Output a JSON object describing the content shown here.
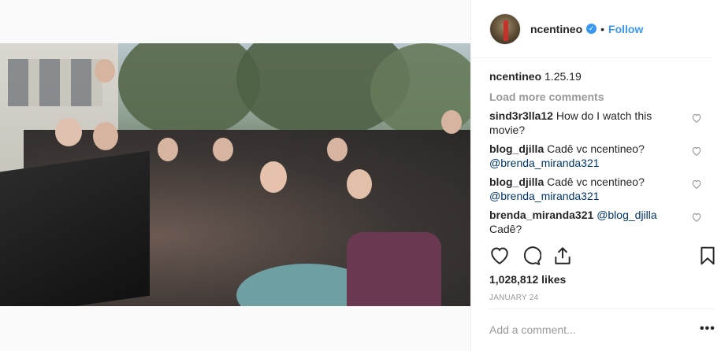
{
  "post": {
    "username": "ncentineo",
    "follow_label": "Follow",
    "separator": "•",
    "caption_text": "1.25.19",
    "load_more_label": "Load more comments",
    "comments": [
      {
        "user": "sind3r3lla12",
        "text": "How do I watch this movie?",
        "mention": ""
      },
      {
        "user": "blog_djilla",
        "text": "Cadê vc ncentineo?",
        "mention": "@brenda_miranda321"
      },
      {
        "user": "blog_djilla",
        "text": "Cadê vc ncentineo?",
        "mention": "@brenda_miranda321"
      },
      {
        "user": "brenda_miranda321",
        "text": "Cadê?",
        "mention": "@blog_djilla"
      }
    ],
    "likes": "1,028,812 likes",
    "date": "JANUARY 24",
    "add_comment_placeholder": "Add a comment...",
    "more_label": "•••"
  },
  "colors": {
    "accent": "#3897f0",
    "mention": "#003569",
    "muted": "#999999"
  },
  "icons": [
    "verified-badge-icon",
    "heart-icon",
    "comment-icon",
    "share-icon",
    "bookmark-icon",
    "small-heart-icon"
  ]
}
